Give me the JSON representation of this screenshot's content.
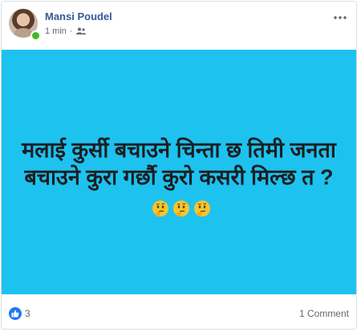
{
  "post": {
    "author": "Mansi Poudel",
    "time": "1 min",
    "separator": "·",
    "privacy_icon": "friends-icon",
    "status_text": "मलाई कुर्सी बचाउने चिन्ता छ तिमी जनता बचाउने कुरा गर्छौ कुरो कसरी मिल्छ त ?",
    "emoji": [
      "thinking-face-emoji",
      "thinking-face-emoji",
      "thinking-face-emoji"
    ],
    "background_color": "#1ec2ef",
    "reactions": {
      "icon": "like-icon",
      "count": "3"
    },
    "comments": "1 Comment"
  }
}
